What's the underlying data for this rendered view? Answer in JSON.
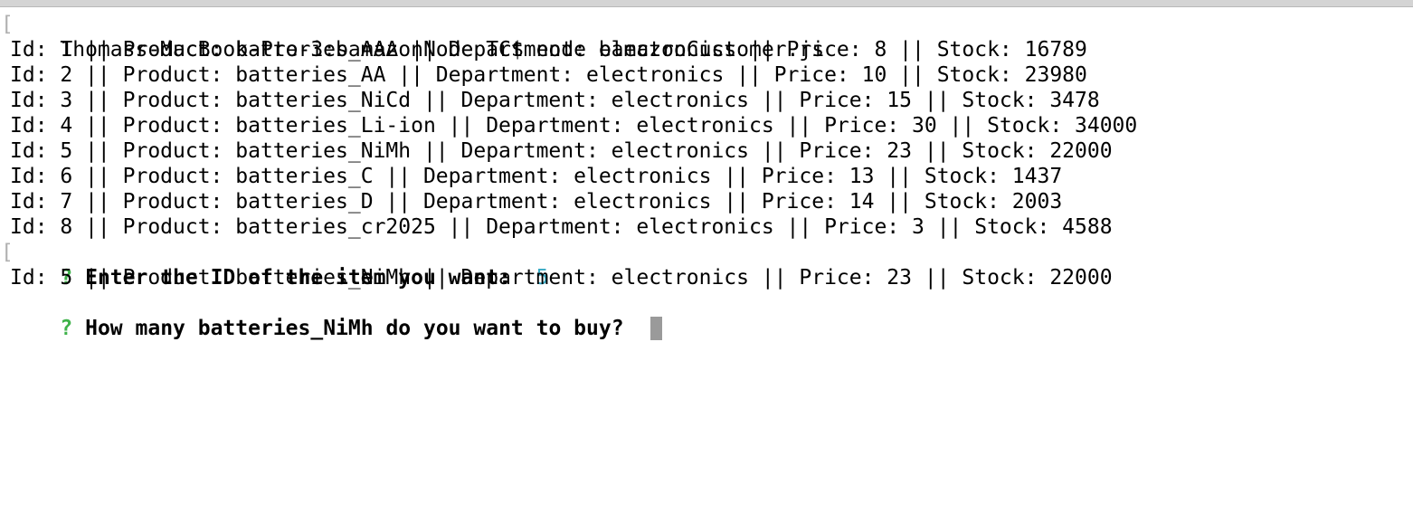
{
  "terminal": {
    "command_line": "Thomass-MacBook-Pro-3:bamazonNode TC$ node bamazonCustomer.js",
    "products": [
      "Id: 1 || Product: batteries_AAA || Department: electronics || Price: 8 || Stock: 16789",
      "Id: 2 || Product: batteries_AA || Department: electronics || Price: 10 || Stock: 23980",
      "Id: 3 || Product: batteries_NiCd || Department: electronics || Price: 15 || Stock: 3478",
      "Id: 4 || Product: batteries_Li-ion || Department: electronics || Price: 30 || Stock: 34000",
      "Id: 5 || Product: batteries_NiMh || Department: electronics || Price: 23 || Stock: 22000",
      "Id: 6 || Product: batteries_C || Department: electronics || Price: 13 || Stock: 1437",
      "Id: 7 || Product: batteries_D || Department: electronics || Price: 14 || Stock: 2003",
      "Id: 8 || Product: batteries_cr2025 || Department: electronics || Price: 3 || Stock: 4588"
    ],
    "prompt1": {
      "marker": "?",
      "question": "Enter the ID of the item you want:",
      "answer": "5"
    },
    "selected_product": "Id: 5 || Product: batteries_NiMh || Department: electronics || Price: 23 || Stock: 22000",
    "prompt2": {
      "marker": "?",
      "question": "How many batteries_NiMh do you want to buy?"
    },
    "colors": {
      "prompt_marker": "#3fb24a",
      "answer": "#37a9c4",
      "cursor": "#9a9a9a",
      "text": "#000000"
    }
  }
}
